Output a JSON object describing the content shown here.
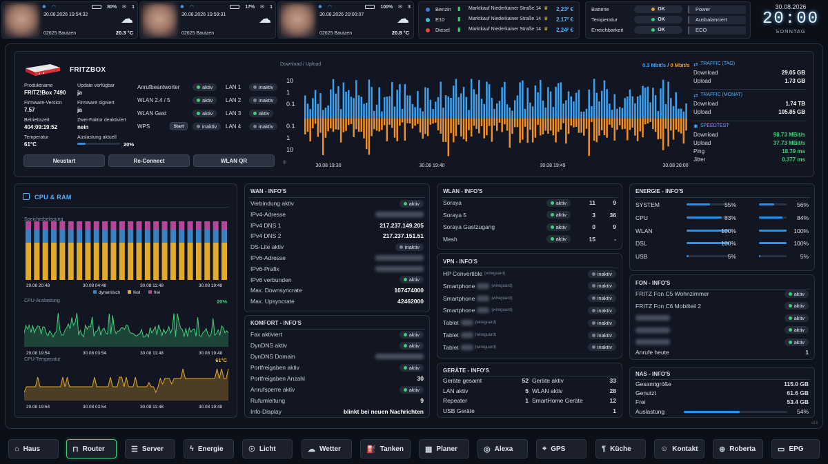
{
  "persons": [
    {
      "time": "30.08.2026 19:54:32",
      "battery": "80%",
      "mail": "1",
      "postal": "02625 Bautzen",
      "temp": "20.3 °C"
    },
    {
      "time": "30.08.2026 19:59:31",
      "battery": "17%",
      "mail": "1",
      "postal": "02625 Bautzen",
      "temp": ""
    },
    {
      "time": "30.08.2026 20:00:07",
      "battery": "100%",
      "mail": "3",
      "postal": "02625 Bautzen",
      "temp": "20.8 °C"
    }
  ],
  "fuel": [
    {
      "type": "Benzin",
      "station": "Marktkauf Niederkainer Straße 14",
      "price": "2,23² €",
      "color": "#2f7de0"
    },
    {
      "type": "E10",
      "station": "Marktkauf Niederkainer Straße 14",
      "price": "2,17² €",
      "color": "#2fc0e0"
    },
    {
      "type": "Diesel",
      "station": "Marktkauf Niederkainer Straße 14",
      "price": "2,24² €",
      "color": "#e04a3f"
    }
  ],
  "status": {
    "rows": [
      {
        "label": "Batterie",
        "value": "OK",
        "dot": "#e0a030"
      },
      {
        "label": "Temperatur",
        "value": "OK",
        "dot": "#3fd07a"
      },
      {
        "label": "Erreichbarkeit",
        "value": "OK",
        "dot": "#3fd07a"
      }
    ],
    "modes": [
      "Power",
      "Ausbalanciert",
      "ECO"
    ]
  },
  "clock": {
    "date": "30.08.2026",
    "time": "20:00",
    "day": "SONNTAG"
  },
  "fritz": {
    "title": "FRITZBOX",
    "info": [
      {
        "label": "Produktname",
        "value": "FRITZ!Box 7490"
      },
      {
        "label": "Update verfügbar",
        "value": "ja"
      },
      {
        "label": "Firmware-Version",
        "value": "7.57"
      },
      {
        "label": "Firmware signiert",
        "value": "ja"
      },
      {
        "label": "Betriebszeit",
        "value": "404:09:19:52"
      },
      {
        "label": "Zwei-Faktor deaktiviert",
        "value": "nein"
      },
      {
        "label": "Temperatur",
        "value": "61°C"
      },
      {
        "label": "Auslastung aktuell",
        "value": "20%"
      }
    ],
    "load_fraction": 0.2,
    "toggles": [
      {
        "label": "Anrufbeantworter",
        "state": "aktiv",
        "on": true
      },
      {
        "label": "WLAN 2.4 / 5",
        "state": "aktiv",
        "on": true
      },
      {
        "label": "WLAN Gast",
        "state": "aktiv",
        "on": true
      },
      {
        "label": "WPS",
        "state": "inaktiv",
        "on": false,
        "button": "Start"
      }
    ],
    "lans": [
      {
        "label": "LAN 1",
        "state": "inaktiv",
        "on": false
      },
      {
        "label": "LAN 2",
        "state": "inaktiv",
        "on": false
      },
      {
        "label": "LAN 3",
        "state": "aktiv",
        "on": true
      },
      {
        "label": "LAN 4",
        "state": "inaktiv",
        "on": false
      }
    ],
    "buttons": [
      "Neustart",
      "Re-Connect",
      "WLAN QR"
    ]
  },
  "traffic_chart": {
    "label": "Download / Upload",
    "legend_down": "0.3 Mbit/s",
    "legend_sep": "/",
    "legend_up": "0 Mbit/s",
    "ticks": [
      "10",
      "1",
      "0.1",
      "0.1",
      "1",
      "10"
    ],
    "xticks": [
      "30.08 19:30",
      "30.08 19:40",
      "30.08 19:49",
      "30.08 20:00"
    ]
  },
  "traffic": {
    "day_title": "TRAFFIC (TAG)",
    "day": [
      {
        "label": "Download",
        "value": "29.05 GB"
      },
      {
        "label": "Upload",
        "value": "1.73 GB"
      }
    ],
    "month_title": "TRAFFIC (MONAT)",
    "month": [
      {
        "label": "Download",
        "value": "1.74 TB"
      },
      {
        "label": "Upload",
        "value": "105.85 GB"
      }
    ],
    "speed_title": "SPEEDTEST",
    "speed": [
      {
        "label": "Download",
        "value": "98.73 MBit/s"
      },
      {
        "label": "Upload",
        "value": "37.73 MBit/s"
      },
      {
        "label": "Ping",
        "value": "18.79 ms"
      },
      {
        "label": "Jitter",
        "value": "0.377 ms"
      }
    ]
  },
  "cpu": {
    "title": "CPU & RAM",
    "mem_label": "Speicherbelegung",
    "mem_xticks": [
      "29.08 20:48",
      "30.08 04:48",
      "30.08 11:48",
      "30.08 19:48"
    ],
    "legend": [
      "dynamisch",
      "fest",
      "frei"
    ],
    "cpu_label": "CPU-Auslastung",
    "cpu_value": "20%",
    "cpu_xticks": [
      "29.08 19:54",
      "30.08 03:54",
      "30.08 11:48",
      "30.08 19:48"
    ],
    "temp_label": "CPU-Temperatur",
    "temp_value": "61°C",
    "temp_xticks": [
      "29.08 19:54",
      "30.08 03:54",
      "30.08 11:48",
      "30.08 19:48"
    ]
  },
  "wan": {
    "title": "WAN - INFO'S",
    "rows": [
      {
        "label": "Verbindung aktiv",
        "pill": "aktiv",
        "on": true
      },
      {
        "label": "IPv4-Adresse",
        "blur": true
      },
      {
        "label": "IPv4 DNS 1",
        "value": "217.237.149.205"
      },
      {
        "label": "IPv4 DNS 2",
        "value": "217.237.151.51"
      },
      {
        "label": "DS-Lite aktiv",
        "pill": "inaktiv",
        "on": false
      },
      {
        "label": "IPv6-Adresse",
        "blur": true
      },
      {
        "label": "IPv6-Prafix",
        "blur": true
      },
      {
        "label": "IPv6 verbunden",
        "pill": "aktiv",
        "on": true
      },
      {
        "label": "Max. Downsyncrate",
        "value": "107474000"
      },
      {
        "label": "Max. Upsyncrate",
        "value": "42462000"
      }
    ]
  },
  "komfort": {
    "title": "KOMFORT - INFO'S",
    "rows": [
      {
        "label": "Fax aktiviert",
        "pill": "aktiv",
        "on": true
      },
      {
        "label": "DynDNS aktiv",
        "pill": "aktiv",
        "on": true
      },
      {
        "label": "DynDNS Domain",
        "blur": true
      },
      {
        "label": "Portfreigaben aktiv",
        "pill": "aktiv",
        "on": true
      },
      {
        "label": "Portfreigaben Anzahl",
        "value": "30"
      },
      {
        "label": "Anrufsperre aktiv",
        "pill": "aktiv",
        "on": true
      },
      {
        "label": "Rufumleitung",
        "value": "9"
      },
      {
        "label": "Info-Display",
        "value": "blinkt bei neuen Nachrichten"
      }
    ]
  },
  "wlan": {
    "title": "WLAN - INFO'S",
    "rows": [
      {
        "label": "Soraya",
        "pill": "aktiv",
        "a": "11",
        "b": "9"
      },
      {
        "label": "Soraya 5",
        "pill": "aktiv",
        "a": "3",
        "b": "36"
      },
      {
        "label": "Soraya Gastzugang",
        "pill": "aktiv",
        "a": "0",
        "b": "9"
      },
      {
        "label": "Mesh",
        "pill": "aktiv",
        "a": "15",
        "b": "-"
      }
    ]
  },
  "vpn": {
    "title": "VPN - INFO'S",
    "rows": [
      {
        "label": "HP Convertible",
        "tag": "(wireguard)",
        "pill": "inaktiv"
      },
      {
        "label": "Smartphone",
        "tag": "(wireguard)",
        "pill": "inaktiv"
      },
      {
        "label": "Smartphone",
        "tag": "(wireguard)",
        "pill": "inaktiv"
      },
      {
        "label": "Smartphone",
        "tag": "(wireguard)",
        "pill": "inaktiv"
      },
      {
        "label": "Tablet",
        "tag": "(wireguard)",
        "pill": "inaktiv"
      },
      {
        "label": "Tablet",
        "tag": "(wireguard)",
        "pill": "inaktiv"
      },
      {
        "label": "Tablet",
        "tag": "(wireguard)",
        "pill": "inaktiv"
      }
    ]
  },
  "geraete": {
    "title": "GERÄTE - INFO'S",
    "rows": [
      {
        "l1": "Geräte gesamt",
        "v1": "52",
        "l2": "Geräte aktiv",
        "v2": "33"
      },
      {
        "l1": "LAN aktiv",
        "v1": "5",
        "l2": "WLAN aktiv",
        "v2": "28"
      },
      {
        "l1": "Repeater",
        "v1": "1",
        "l2": "SmartHome Geräte",
        "v2": "12"
      },
      {
        "l1": "USB Geräte",
        "v1": "",
        "l2": "",
        "v2": "1"
      }
    ]
  },
  "energie": {
    "title": "ENERGIE - INFO'S",
    "rows": [
      {
        "label": "SYSTEM",
        "v1": "55%",
        "f1": 0.55,
        "v2": "56%",
        "f2": 0.56
      },
      {
        "label": "CPU",
        "v1": "83%",
        "f1": 0.83,
        "v2": "84%",
        "f2": 0.84
      },
      {
        "label": "WLAN",
        "v1": "100%",
        "f1": 1.0,
        "v2": "100%",
        "f2": 1.0
      },
      {
        "label": "DSL",
        "v1": "100%",
        "f1": 1.0,
        "v2": "100%",
        "f2": 1.0
      },
      {
        "label": "USB",
        "v1": "5%",
        "f1": 0.05,
        "v2": "5%",
        "f2": 0.05
      }
    ]
  },
  "fon": {
    "title": "FON - INFO'S",
    "rows": [
      {
        "label": "FRITZ Fon C5 Wohnzimmer",
        "pill": "aktiv"
      },
      {
        "label": "FRITZ Fon C6 Mobilteil 2",
        "pill": "aktiv"
      },
      {
        "label": "",
        "pill": "aktiv"
      },
      {
        "label": "",
        "pill": "aktiv"
      },
      {
        "label": "",
        "pill": "aktiv"
      }
    ],
    "calls_label": "Anrufe heute",
    "calls_value": "1"
  },
  "nas": {
    "title": "NAS - INFO'S",
    "rows": [
      {
        "label": "Gesamtgröße",
        "value": "115.0 GB"
      },
      {
        "label": "Genutzt",
        "value": "61.6 GB"
      },
      {
        "label": "Frei",
        "value": "53.4 GB"
      }
    ],
    "load_label": "Auslastung",
    "load_value": "54%",
    "load_fraction": 0.54
  },
  "version": "v3.0",
  "nav": [
    {
      "label": "Haus",
      "icon": "home-icon",
      "glyph": "⌂"
    },
    {
      "label": "Router",
      "icon": "router-icon",
      "glyph": "⊓",
      "active": true
    },
    {
      "label": "Server",
      "icon": "server-icon",
      "glyph": "☰"
    },
    {
      "label": "Energie",
      "icon": "bolt-icon",
      "glyph": "ϟ"
    },
    {
      "label": "Licht",
      "icon": "bulb-icon",
      "glyph": "☉"
    },
    {
      "label": "Wetter",
      "icon": "cloud-icon",
      "glyph": "☁"
    },
    {
      "label": "Tanken",
      "icon": "fuel-icon",
      "glyph": "⛽"
    },
    {
      "label": "Planer",
      "icon": "calendar-icon",
      "glyph": "▦"
    },
    {
      "label": "Alexa",
      "icon": "alexa-icon",
      "glyph": "◎"
    },
    {
      "label": "GPS",
      "icon": "pin-icon",
      "glyph": "⌖"
    },
    {
      "label": "Küche",
      "icon": "utensils-icon",
      "glyph": "¶"
    },
    {
      "label": "Kontakt",
      "icon": "contacts-icon",
      "glyph": "☺"
    },
    {
      "label": "Roberta",
      "icon": "robot-icon",
      "glyph": "⊕"
    },
    {
      "label": "EPG",
      "icon": "tv-icon",
      "glyph": "▭"
    }
  ]
}
